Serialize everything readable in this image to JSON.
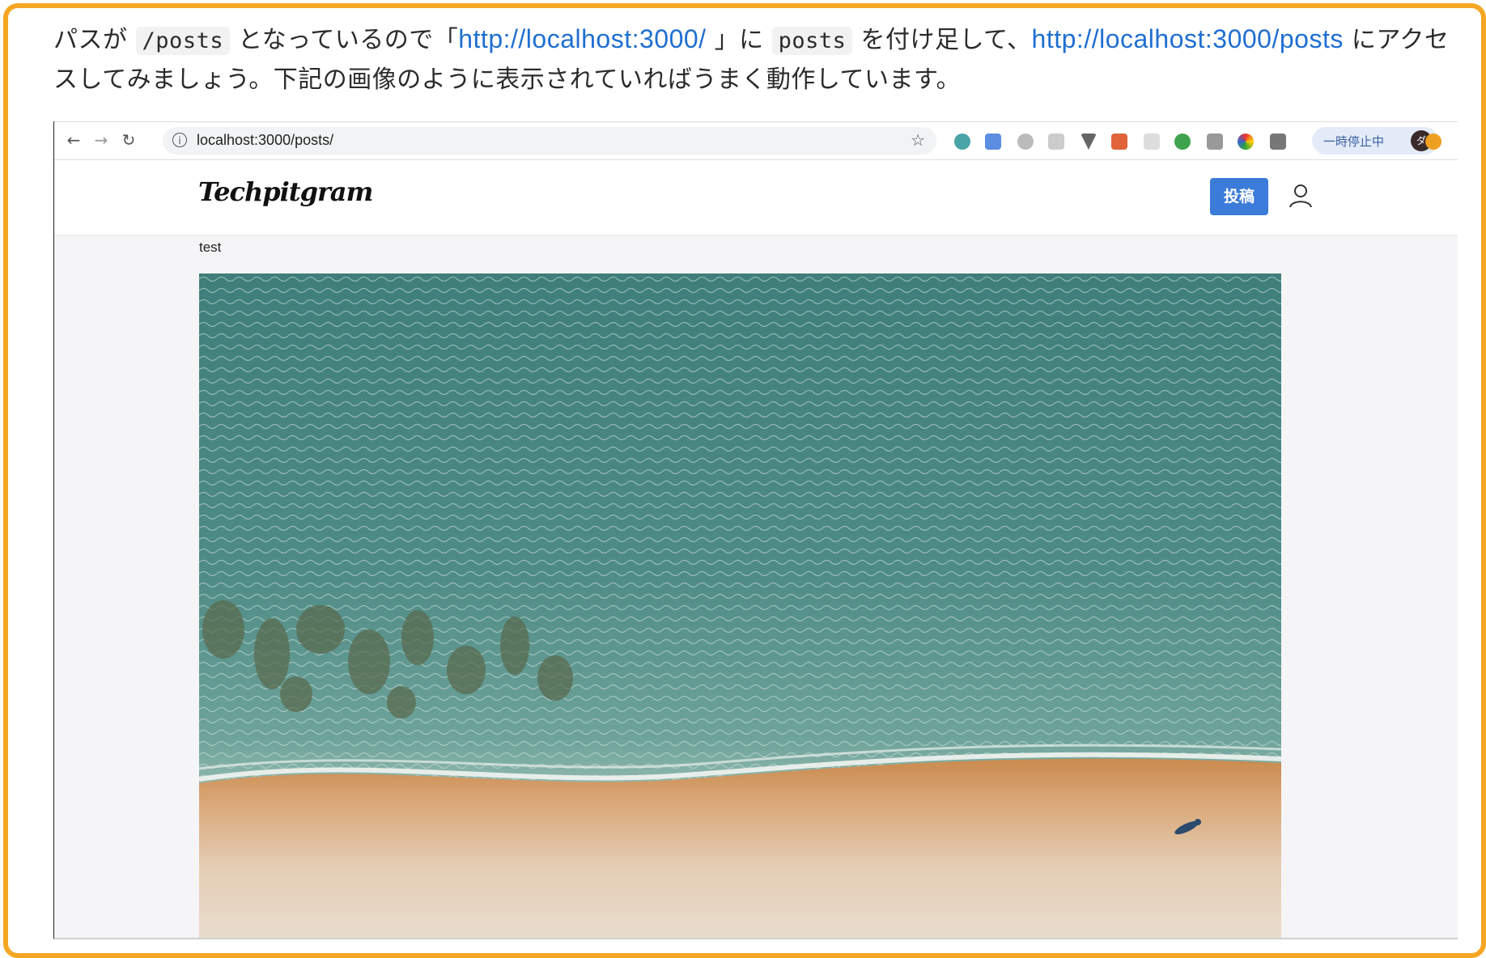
{
  "intro": {
    "part1": "パスが ",
    "code1": "/posts",
    "part2": " となっているので「",
    "link1": "http://localhost:3000/",
    "part3": " 」に ",
    "code2": "posts",
    "part4": " を付け足して、",
    "link2": "http://localhost:3000/posts",
    "part5": " にアクセスしてみましょう。下記の画像のように表示されていればうまく動作しています。"
  },
  "browser": {
    "url": "localhost:3000/posts/",
    "pause_label": "一時停止中",
    "avatar_letter": "ダ"
  },
  "app": {
    "logo": "Techpitgram",
    "post_button": "投稿",
    "post_caption": "test"
  },
  "colors": {
    "frame": "#f5a623",
    "link": "#1f6fd1",
    "post_button": "#3b7bd9"
  }
}
